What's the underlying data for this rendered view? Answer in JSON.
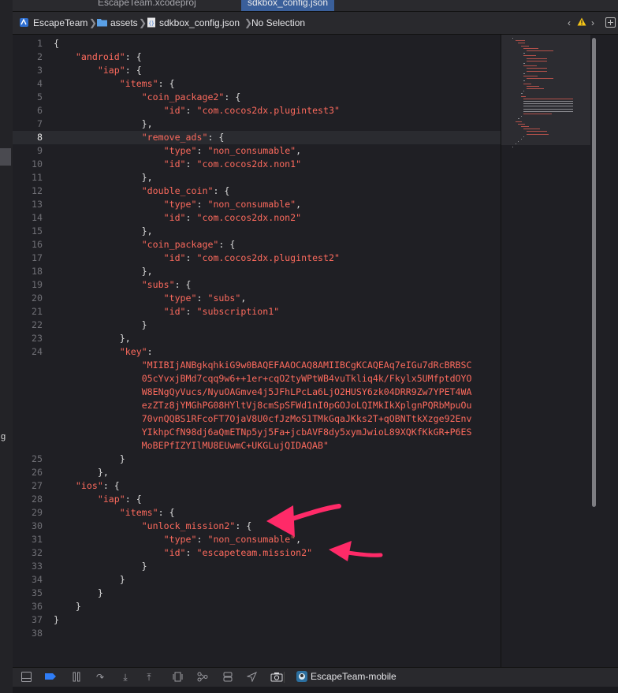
{
  "tabs": [
    {
      "label": "EscapeTeam.xcodeproj",
      "active": false
    },
    {
      "label": "sdkbox_config.json",
      "active": true
    }
  ],
  "breadcrumb": {
    "project": "EscapeTeam",
    "folder": "assets",
    "file": "sdkbox_config.json",
    "selection": "No Selection"
  },
  "left_strip_letter": "g",
  "editor": {
    "current_line": 8,
    "lines": [
      {
        "n": "1",
        "t": "{"
      },
      {
        "n": "2",
        "t": "    \"android\": {"
      },
      {
        "n": "3",
        "t": "        \"iap\": {"
      },
      {
        "n": "4",
        "t": "            \"items\": {"
      },
      {
        "n": "5",
        "t": "                \"coin_package2\": {"
      },
      {
        "n": "6",
        "t": "                    \"id\": \"com.cocos2dx.plugintest3\""
      },
      {
        "n": "7",
        "t": "                },"
      },
      {
        "n": "8",
        "t": "                \"remove_ads\": {"
      },
      {
        "n": "9",
        "t": "                    \"type\": \"non_consumable\","
      },
      {
        "n": "10",
        "t": "                    \"id\": \"com.cocos2dx.non1\""
      },
      {
        "n": "11",
        "t": "                },"
      },
      {
        "n": "12",
        "t": "                \"double_coin\": {"
      },
      {
        "n": "13",
        "t": "                    \"type\": \"non_consumable\","
      },
      {
        "n": "14",
        "t": "                    \"id\": \"com.cocos2dx.non2\""
      },
      {
        "n": "15",
        "t": "                },"
      },
      {
        "n": "16",
        "t": "                \"coin_package\": {"
      },
      {
        "n": "17",
        "t": "                    \"id\": \"com.cocos2dx.plugintest2\""
      },
      {
        "n": "18",
        "t": "                },"
      },
      {
        "n": "19",
        "t": "                \"subs\": {"
      },
      {
        "n": "20",
        "t": "                    \"type\": \"subs\","
      },
      {
        "n": "21",
        "t": "                    \"id\": \"subscription1\""
      },
      {
        "n": "22",
        "t": "                }"
      },
      {
        "n": "23",
        "t": "            },"
      },
      {
        "n": "24",
        "t": "            \"key\":"
      },
      {
        "n": "",
        "t": "                \"MIIBIjANBgkqhkiG9w0BAQEFAAOCAQ8AMIIBCgKCAQEAq7eIGu7dRcBRBSC"
      },
      {
        "n": "",
        "t": "                05cYvxjBMd7cqq9w6++1er+cqO2tyWPtWB4vuTkliq4k/Fkylx5UMfptdOYO"
      },
      {
        "n": "",
        "t": "                W8ENgQyVucs/NyuOAGmve4j5JFhLPcLa6LjO2HUSY6zk04DRR9Zw7YPET4WA"
      },
      {
        "n": "",
        "t": "                ezZTz8jYMGhPG08HYltVj8cmSpSFWd1nI0pGOJoLQIMkIkXplgnPQRbMpuOu"
      },
      {
        "n": "",
        "t": "                70vnQQBS1RFcoFT7OjaV8U0cfJzMoS1TMkGqaJKks2T+qOBNTtkXzge92Env"
      },
      {
        "n": "",
        "t": "                YIkhpCfN98dj6aQmETNp5yj5Fa+jcbAVF8dy5xymJwioL89XQKfKkGR+P6ES"
      },
      {
        "n": "",
        "t": "                MoBEPfIZYIlMU8EUwmC+UKGLujQIDAQAB\""
      },
      {
        "n": "25",
        "t": "            }"
      },
      {
        "n": "26",
        "t": "        },"
      },
      {
        "n": "27",
        "t": "    \"ios\": {"
      },
      {
        "n": "28",
        "t": "        \"iap\": {"
      },
      {
        "n": "29",
        "t": "            \"items\": {"
      },
      {
        "n": "30",
        "t": "                \"unlock_mission2\": {"
      },
      {
        "n": "31",
        "t": "                    \"type\": \"non_consumable\","
      },
      {
        "n": "32",
        "t": "                    \"id\": \"escapeteam.mission2\""
      },
      {
        "n": "33",
        "t": "                }"
      },
      {
        "n": "34",
        "t": "            }"
      },
      {
        "n": "35",
        "t": "        }"
      },
      {
        "n": "36",
        "t": "    }"
      },
      {
        "n": "37",
        "t": "}"
      },
      {
        "n": "38",
        "t": ""
      }
    ]
  },
  "bottom": {
    "scheme": "EscapeTeam-mobile",
    "icons": [
      "hide-panel-icon",
      "breakpoint-icon",
      "pause-icon",
      "step-over-icon",
      "step-into-icon",
      "step-out-icon",
      "view-debugger-icon",
      "memory-graph-icon",
      "environment-icon",
      "location-icon",
      "camera-icon"
    ]
  },
  "colors": {
    "string": "#fc6a5d",
    "plain": "#dcdcdc",
    "annotation": "#ff2a68",
    "active_tab": "#3a5f9a"
  }
}
